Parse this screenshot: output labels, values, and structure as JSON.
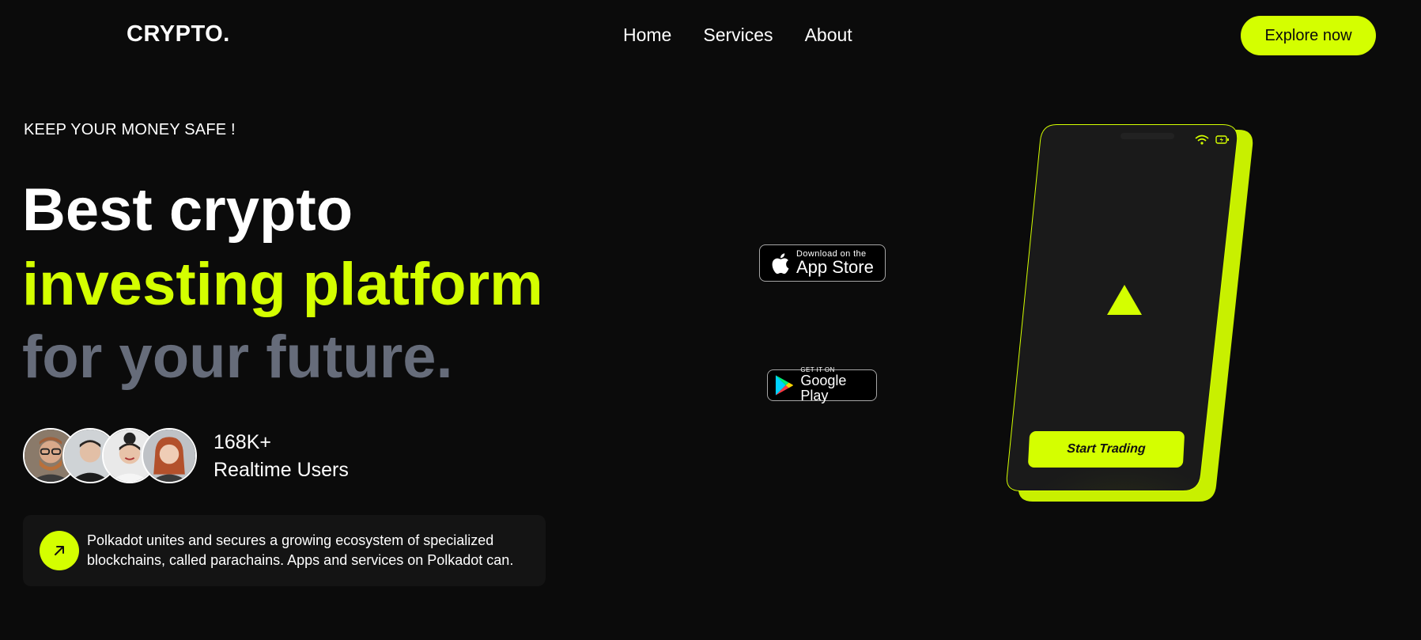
{
  "brand": {
    "logo": "CRYPTO.",
    "accent": "#d4ff00",
    "background": "#0b0b0b",
    "muted": "#666c7a"
  },
  "nav": {
    "items": [
      {
        "label": "Home"
      },
      {
        "label": "Services"
      },
      {
        "label": "About"
      }
    ]
  },
  "header": {
    "cta_label": "Explore now"
  },
  "hero": {
    "eyebrow": "KEEP YOUR MONEY SAFE !",
    "headline_line1": "Best crypto",
    "headline_line2": "investing platform",
    "headline_line3": "for your future.",
    "users_count": "168K+",
    "users_label": "Realtime Users",
    "avatars": [
      "user-avatar-1",
      "user-avatar-2",
      "user-avatar-3",
      "user-avatar-4"
    ],
    "info_text": "Polkadot unites and secures a growing ecosystem of specialized blockchains, called parachains. Apps and services on Polkadot can."
  },
  "badges": {
    "apple": {
      "small": "Download on the",
      "big": "App Store",
      "icon": "apple-icon"
    },
    "google": {
      "small": "GET IT ON",
      "big": "Google Play",
      "icon": "google-play-icon"
    }
  },
  "phone": {
    "button_label": "Start Trading",
    "icons": [
      "wifi-icon",
      "battery-icon",
      "triangle-logo-icon"
    ]
  }
}
